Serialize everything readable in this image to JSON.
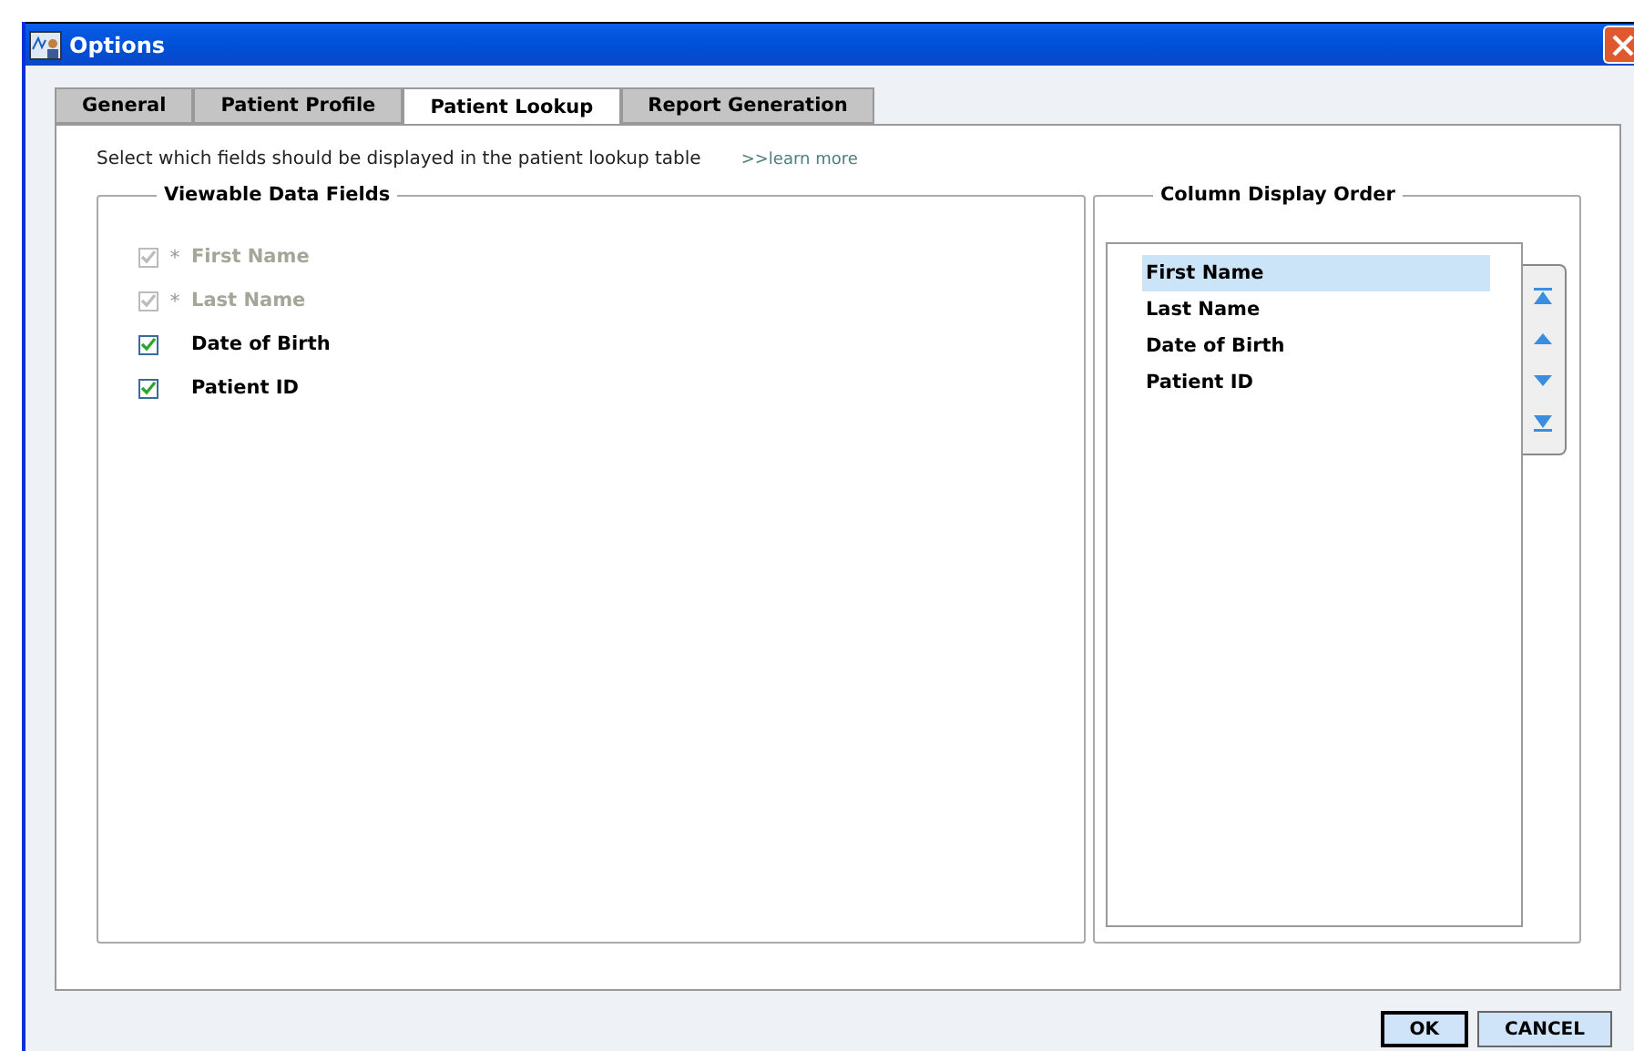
{
  "window": {
    "title": "Options"
  },
  "tabs": [
    {
      "label": "General",
      "selected": false
    },
    {
      "label": "Patient Profile",
      "selected": false
    },
    {
      "label": "Patient Lookup",
      "selected": true
    },
    {
      "label": "Report Generation",
      "selected": false
    }
  ],
  "instruction": "Select which fields should be displayed in the patient lookup table",
  "learn_more": ">>learn more",
  "viewable_fields": {
    "title": "Viewable Data Fields",
    "items": [
      {
        "label": "First Name",
        "required": "*",
        "checked": true,
        "disabled": true
      },
      {
        "label": "Last Name",
        "required": "*",
        "checked": true,
        "disabled": true
      },
      {
        "label": "Date of Birth",
        "checked": true,
        "disabled": false
      },
      {
        "label": "Patient ID",
        "checked": true,
        "disabled": false
      }
    ]
  },
  "column_order": {
    "title": "Column Display Order",
    "items": [
      {
        "label": "First Name",
        "selected": true
      },
      {
        "label": "Last Name",
        "selected": false
      },
      {
        "label": "Date of Birth",
        "selected": false
      },
      {
        "label": "Patient ID",
        "selected": false
      }
    ]
  },
  "buttons": [
    "OK",
    "CANCEL"
  ]
}
